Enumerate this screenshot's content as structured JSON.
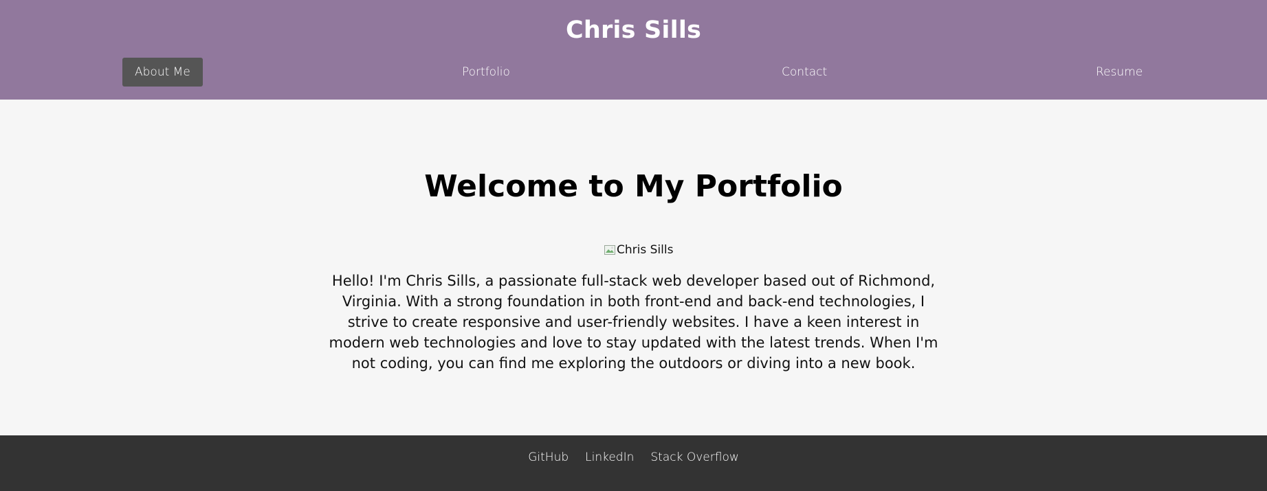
{
  "header": {
    "title": "Chris Sills",
    "background_color": "#91789d",
    "nav": [
      {
        "label": "About Me",
        "active": true
      },
      {
        "label": "Portfolio",
        "active": false
      },
      {
        "label": "Contact",
        "active": false
      },
      {
        "label": "Resume",
        "active": false
      }
    ]
  },
  "main": {
    "heading": "Welcome to My Portfolio",
    "image_alt": "Chris Sills",
    "image_icon": "broken-image-icon",
    "bio": "Hello! I'm Chris Sills, a passionate full-stack web developer based out of Richmond, Virginia. With a strong foundation in both front-end and back-end technologies, I strive to create responsive and user-friendly websites. I have a keen interest in modern web technologies and love to stay updated with the latest trends. When I'm not coding, you can find me exploring the outdoors or diving into a new book."
  },
  "footer": {
    "background_color": "#333333",
    "links": [
      {
        "label": "GitHub"
      },
      {
        "label": "LinkedIn"
      },
      {
        "label": "Stack Overflow"
      }
    ]
  }
}
